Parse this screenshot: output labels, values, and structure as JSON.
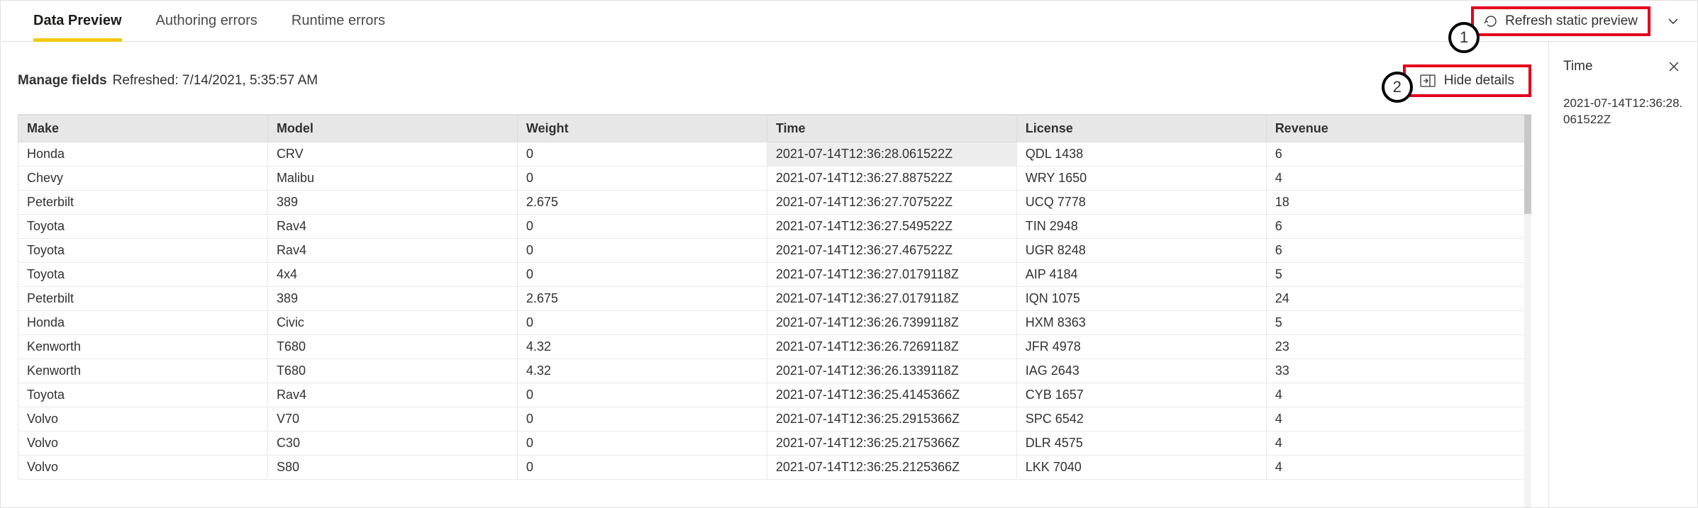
{
  "tabs": {
    "data_preview": "Data Preview",
    "authoring_errors": "Authoring errors",
    "runtime_errors": "Runtime errors"
  },
  "toolbar": {
    "refresh_label": "Refresh static preview"
  },
  "callouts": {
    "one": "1",
    "two": "2"
  },
  "manage": {
    "title": "Manage fields",
    "refreshed_label": "Refreshed: 7/14/2021, 5:35:57 AM",
    "hide_details_label": "Hide details"
  },
  "table": {
    "headers": {
      "make": "Make",
      "model": "Model",
      "weight": "Weight",
      "time": "Time",
      "license": "License",
      "revenue": "Revenue"
    },
    "rows": [
      {
        "make": "Honda",
        "model": "CRV",
        "weight": "0",
        "time": "2021-07-14T12:36:28.061522Z",
        "license": "QDL 1438",
        "revenue": "6",
        "time_selected": true
      },
      {
        "make": "Chevy",
        "model": "Malibu",
        "weight": "0",
        "time": "2021-07-14T12:36:27.887522Z",
        "license": "WRY 1650",
        "revenue": "4"
      },
      {
        "make": "Peterbilt",
        "model": "389",
        "weight": "2.675",
        "time": "2021-07-14T12:36:27.707522Z",
        "license": "UCQ 7778",
        "revenue": "18"
      },
      {
        "make": "Toyota",
        "model": "Rav4",
        "weight": "0",
        "time": "2021-07-14T12:36:27.549522Z",
        "license": "TIN 2948",
        "revenue": "6"
      },
      {
        "make": "Toyota",
        "model": "Rav4",
        "weight": "0",
        "time": "2021-07-14T12:36:27.467522Z",
        "license": "UGR 8248",
        "revenue": "6"
      },
      {
        "make": "Toyota",
        "model": "4x4",
        "weight": "0",
        "time": "2021-07-14T12:36:27.0179118Z",
        "license": "AIP 4184",
        "revenue": "5"
      },
      {
        "make": "Peterbilt",
        "model": "389",
        "weight": "2.675",
        "time": "2021-07-14T12:36:27.0179118Z",
        "license": "IQN 1075",
        "revenue": "24"
      },
      {
        "make": "Honda",
        "model": "Civic",
        "weight": "0",
        "time": "2021-07-14T12:36:26.7399118Z",
        "license": "HXM 8363",
        "revenue": "5"
      },
      {
        "make": "Kenworth",
        "model": "T680",
        "weight": "4.32",
        "time": "2021-07-14T12:36:26.7269118Z",
        "license": "JFR 4978",
        "revenue": "23"
      },
      {
        "make": "Kenworth",
        "model": "T680",
        "weight": "4.32",
        "time": "2021-07-14T12:36:26.1339118Z",
        "license": "IAG 2643",
        "revenue": "33"
      },
      {
        "make": "Toyota",
        "model": "Rav4",
        "weight": "0",
        "time": "2021-07-14T12:36:25.4145366Z",
        "license": "CYB 1657",
        "revenue": "4"
      },
      {
        "make": "Volvo",
        "model": "V70",
        "weight": "0",
        "time": "2021-07-14T12:36:25.2915366Z",
        "license": "SPC 6542",
        "revenue": "4"
      },
      {
        "make": "Volvo",
        "model": "C30",
        "weight": "0",
        "time": "2021-07-14T12:36:25.2175366Z",
        "license": "DLR 4575",
        "revenue": "4"
      },
      {
        "make": "Volvo",
        "model": "S80",
        "weight": "0",
        "time": "2021-07-14T12:36:25.2125366Z",
        "license": "LKK 7040",
        "revenue": "4"
      }
    ]
  },
  "sidepanel": {
    "title": "Time",
    "value": "2021-07-14T12:36:28.061522Z"
  }
}
